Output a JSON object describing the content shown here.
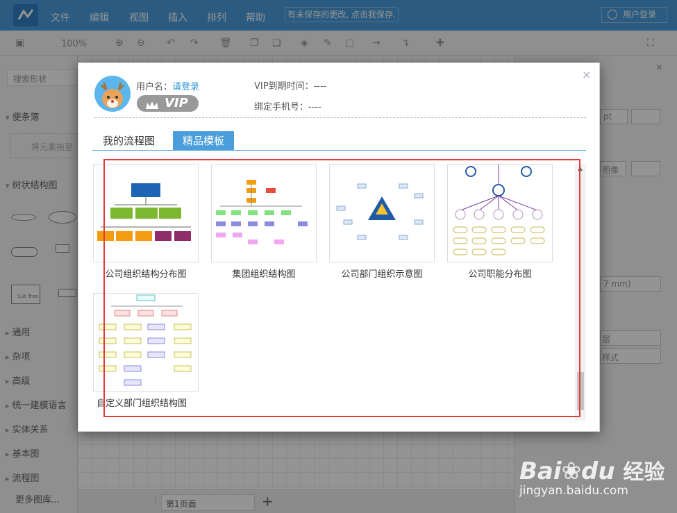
{
  "app": {
    "menu": [
      "文件",
      "编辑",
      "视图",
      "插入",
      "排列",
      "帮助"
    ],
    "unsaved_notice": "有未保存的更改, 点击我保存.",
    "login_button": "用户登录",
    "zoom": "100%"
  },
  "left_panel": {
    "search_placeholder": "搜索形状",
    "scratchpad": "便条簿",
    "drop_hint": "将元素拖至",
    "tree": "树状结构图",
    "shape_label": "Sub Tree",
    "items": [
      "通用",
      "杂项",
      "高级",
      "统一建模语言",
      "实体关系",
      "基本图",
      "流程图"
    ],
    "more": "更多图库..."
  },
  "bottom": {
    "page_tab": "第1页面",
    "add": "+"
  },
  "right_panel": {
    "unit": "pt",
    "image": "图像",
    "mm": "7 mm)",
    "layer": "层",
    "style": "样式"
  },
  "dialog": {
    "close": "×",
    "username_label": "用户名：",
    "username_link": "请登录",
    "vip": "VIP",
    "vip_expire": "VIP到期时间：----",
    "phone": "绑定手机号：----",
    "tabs": [
      "我的流程图",
      "精品模板"
    ],
    "active_tab": "精品模板",
    "templates": [
      {
        "label": "公司组织结构分布图"
      },
      {
        "label": "集团组织结构图"
      },
      {
        "label": "公司部门组织示意图"
      },
      {
        "label": "公司职能分布图"
      },
      {
        "label": "自定义部门组织结构图"
      }
    ]
  },
  "watermark": {
    "brand": "Bai",
    "brand2": "du",
    "jingyan": "经验",
    "url": "jingyan.baidu.com"
  },
  "colors": {
    "accent": "#4a9edc",
    "highlight": "#e23b3b",
    "link": "#2d95db"
  }
}
